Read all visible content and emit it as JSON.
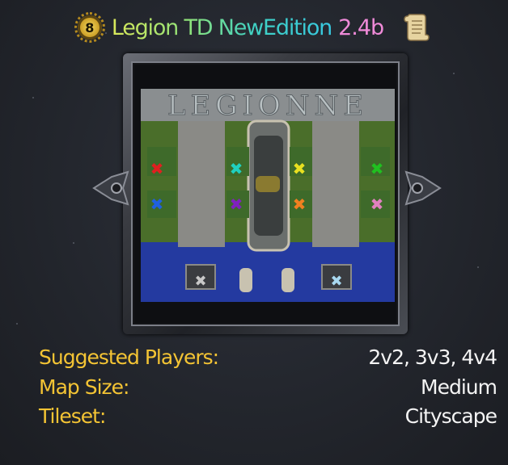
{
  "header": {
    "player_count_badge": "8",
    "map_title": "Legion TD NewEdition",
    "version": "2.4b",
    "scroll_icon": "scroll-icon"
  },
  "preview": {
    "map_banner_text": "LEGIONNE",
    "player_colors": [
      "#e02020",
      "#20d0c0",
      "#e8e020",
      "#20c020",
      "#2060e0",
      "#8020c0",
      "#f08020",
      "#e080c0"
    ],
    "base_colors": [
      "#c8c8c8",
      "#a8d8f0"
    ],
    "prev_icon": "left-arrow-icon",
    "next_icon": "right-arrow-icon"
  },
  "details": [
    {
      "label": "Suggested Players:",
      "value": "2v2, 3v3, 4v4"
    },
    {
      "label": "Map Size:",
      "value": "Medium"
    },
    {
      "label": "Tileset:",
      "value": "Cityscape"
    }
  ],
  "colors": {
    "label": "#f4c434",
    "value": "#f4f4f4",
    "version": "#ef8ad8"
  }
}
